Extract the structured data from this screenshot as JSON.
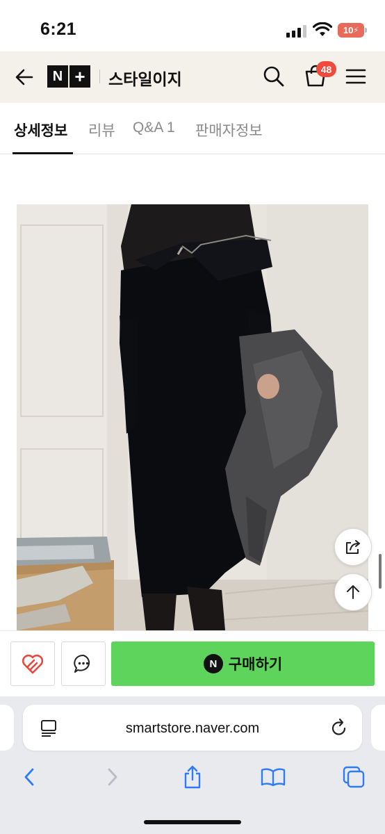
{
  "status_bar": {
    "time": "6:21",
    "battery_level": "10"
  },
  "header": {
    "logo_n": "N",
    "logo_plus": "+",
    "store_title": "스타일이지",
    "cart_count": "48",
    "icons": [
      "back-arrow-icon",
      "search-icon",
      "cart-icon",
      "menu-icon"
    ]
  },
  "tabs": [
    {
      "label": "상세정보",
      "active": true
    },
    {
      "label": "리뷰",
      "active": false
    },
    {
      "label": "Q&A 1",
      "active": false
    },
    {
      "label": "판매자정보",
      "active": false
    }
  ],
  "float_buttons": {
    "icons": [
      "share-icon",
      "arrow-up-icon"
    ]
  },
  "action_bar": {
    "buy_badge": "N",
    "buy_label": "구매하기",
    "buy_color": "#5fd45c",
    "icons": [
      "heart-icon",
      "chat-icon"
    ]
  },
  "browser": {
    "url": "smartstore.naver.com",
    "icons": [
      "reader-icon",
      "reload-icon",
      "back-icon",
      "forward-icon",
      "share-icon",
      "bookmarks-icon",
      "tabs-icon"
    ]
  },
  "colors": {
    "header_bg": "#f4f1ea",
    "badge": "#f0493e",
    "ios_blue": "#2f7bf6"
  }
}
